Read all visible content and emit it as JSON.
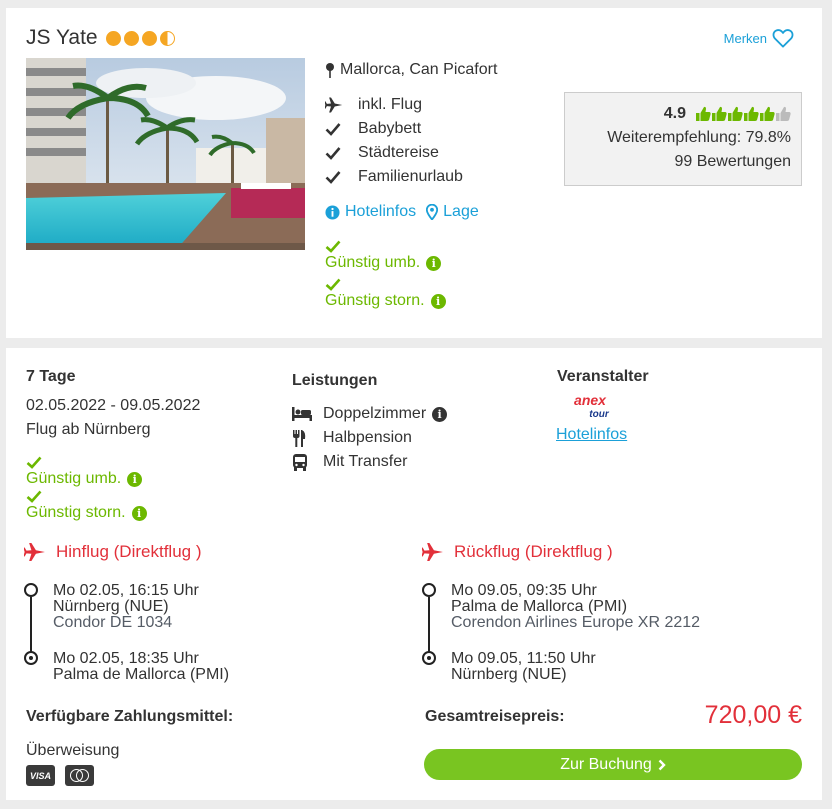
{
  "hotel": {
    "name": "JS Yate",
    "stars_full": 3,
    "stars_half": 1,
    "star_color": "#f5a623",
    "merken_label": "Merken",
    "location": "Mallorca, Can Picafort",
    "features": [
      {
        "icon": "plane-icon",
        "label": "inkl. Flug"
      },
      {
        "icon": "check-icon",
        "label": "Babybett"
      },
      {
        "icon": "check-icon",
        "label": "Städtereise"
      },
      {
        "icon": "check-icon",
        "label": "Familienurlaub"
      }
    ],
    "links": {
      "hotelinfos": "Hotelinfos",
      "lage": "Lage"
    },
    "flags": [
      "Günstig umb.",
      "Günstig storn."
    ],
    "rating": {
      "score": "4.9",
      "thumbs_full": 5,
      "thumbs_total": 6,
      "recommendation": "Weiterempfehlung: 79.8%",
      "reviews": "99 Bewertungen"
    }
  },
  "offer": {
    "duration": "7 Tage",
    "dates": "02.05.2022 - 09.05.2022",
    "departure": "Flug ab Nürnberg",
    "flags": [
      "Günstig umb.",
      "Günstig storn."
    ],
    "leistungen_title": "Leistungen",
    "leistungen": [
      {
        "icon": "bed-icon",
        "label": "Doppelzimmer"
      },
      {
        "icon": "cutlery-icon",
        "label": "Halbpension"
      },
      {
        "icon": "bus-icon",
        "label": "Mit Transfer"
      }
    ],
    "veranstalter_title": "Veranstalter",
    "operator_logo_text": "anex tour",
    "operator_link": "Hotelinfos",
    "outbound": {
      "title": "Hinflug (Direktflug )",
      "dep_time": "Mo 02.05, 16:15 Uhr",
      "dep_airport": "Nürnberg (NUE)",
      "airline": "Condor DE 1034",
      "arr_time": "Mo 02.05, 18:35 Uhr",
      "arr_airport": "Palma de Mallorca (PMI)"
    },
    "inbound": {
      "title": "Rückflug (Direktflug )",
      "dep_time": "Mo 09.05, 09:35 Uhr",
      "dep_airport": "Palma de Mallorca (PMI)",
      "airline": "Corendon Airlines Europe XR 2212",
      "arr_time": "Mo 09.05, 11:50 Uhr",
      "arr_airport": "Nürnberg (NUE)"
    },
    "payment_title": "Verfügbare Zahlungsmittel:",
    "payment_method": "Überweisung",
    "payment_cards": [
      "VISA",
      "Mastercard"
    ],
    "total_label": "Gesamtreisepreis:",
    "total_price": "720,00 €",
    "book_label": "Zur Buchung"
  },
  "colors": {
    "accent_blue": "#1ba0d8",
    "green": "#6cb800",
    "button_green": "#79c521",
    "price_red": "#e2303a"
  }
}
